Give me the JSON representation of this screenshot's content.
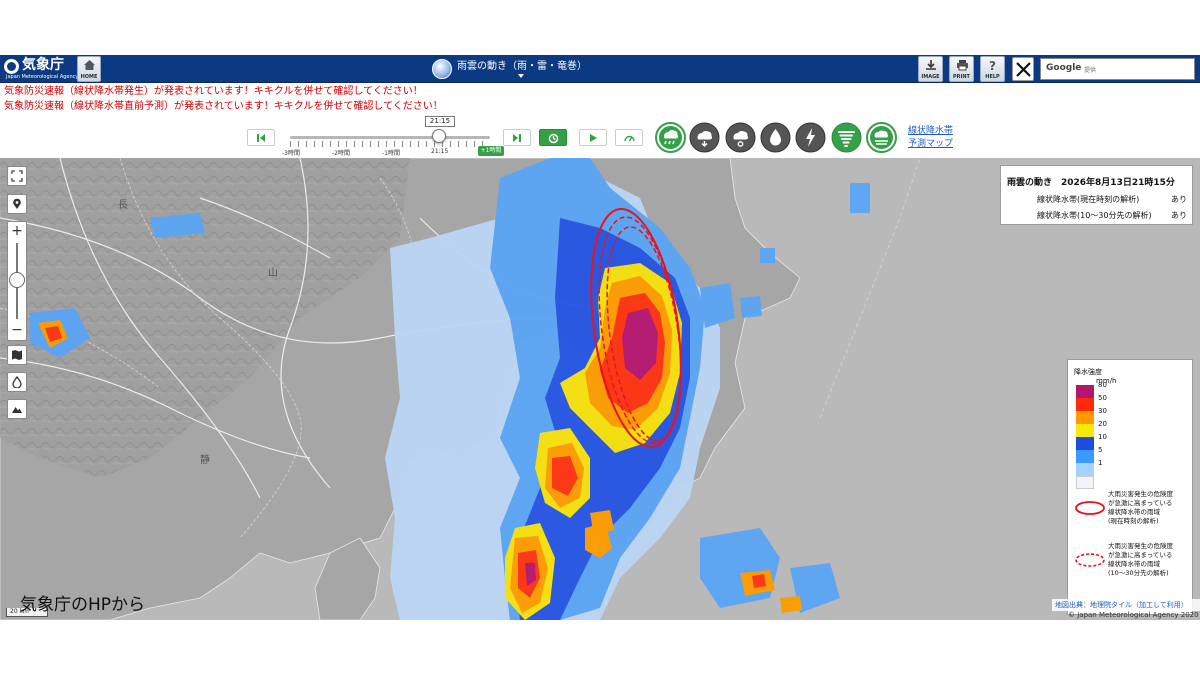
{
  "header": {
    "logo_text": "気象庁",
    "logo_subtext": "Japan Meteorological Agency",
    "home_label": "HOME",
    "title": "雨雲の動き（雨・雷・竜巻）",
    "image_label": "IMAGE",
    "print_label": "PRINT",
    "help_label": "HELP",
    "search_brand": "Google",
    "search_placeholder": "提供"
  },
  "warnings": [
    "気象防災速報（線状降水帯発生）が発表されています！キキクルを併せて確認してください！",
    "気象防災速報（線状降水帯直前予測）が発表されています！キキクルを併せて確認してください！"
  ],
  "timeline": {
    "current_time": "21:15",
    "ticks": [
      "-3時間",
      "-2時間",
      "-1時間",
      "21:15"
    ],
    "future_label": "+1時間",
    "position_fraction": 0.75
  },
  "layers": [
    {
      "name": "rain",
      "active": true
    },
    {
      "name": "cloud-1",
      "active": false
    },
    {
      "name": "cloud-2",
      "active": false
    },
    {
      "name": "drop",
      "active": false
    },
    {
      "name": "thunder",
      "active": false
    },
    {
      "name": "tornado",
      "active": true
    },
    {
      "name": "linear-band",
      "active": true
    }
  ],
  "side_link": {
    "line1": "線状降水帯",
    "line2": "予測マップ"
  },
  "info_box": {
    "title": "雨雲の動き　2026年8月13日21時15分",
    "rows": [
      {
        "label": "線状降水帯(現在時刻の解析)",
        "value": "あり"
      },
      {
        "label": "線状降水帯(10〜30分先の解析)",
        "value": "あり"
      }
    ]
  },
  "legend": {
    "title": "降水強度",
    "unit": "mm/h",
    "levels": [
      {
        "label": "80",
        "color": "#b4166f"
      },
      {
        "label": "50",
        "color": "#ff2a0a"
      },
      {
        "label": "30",
        "color": "#ff9900"
      },
      {
        "label": "20",
        "color": "#f8e90b"
      },
      {
        "label": "10",
        "color": "#1f4ce0"
      },
      {
        "label": "5",
        "color": "#3b9bfa"
      },
      {
        "label": "1",
        "color": "#a5d3ff"
      },
      {
        "label": "",
        "color": "#f0f3f7"
      }
    ],
    "solid_desc": "大雨災害発生の危険度\nが急激に高まっている\n線状降水帯の雨域\n(現在時刻の解析)",
    "dashed_desc": "大雨災害発生の危険度\nが急激に高まっている\n線状降水帯の雨域\n(10〜30分先の解析)"
  },
  "map": {
    "place_labels": [
      "長",
      "山",
      "静"
    ],
    "scale_label": "20 km",
    "caption": "気象庁のHPから",
    "attribution": "地図出典：地理院タイル（加工して利用）",
    "copyright": "© Japan Meteorological Agency 2020"
  },
  "colors": {
    "header_bg": "#0c3a82",
    "warning": "#d10000",
    "accent_green": "#35a047",
    "band_outline": "#e8141c"
  }
}
